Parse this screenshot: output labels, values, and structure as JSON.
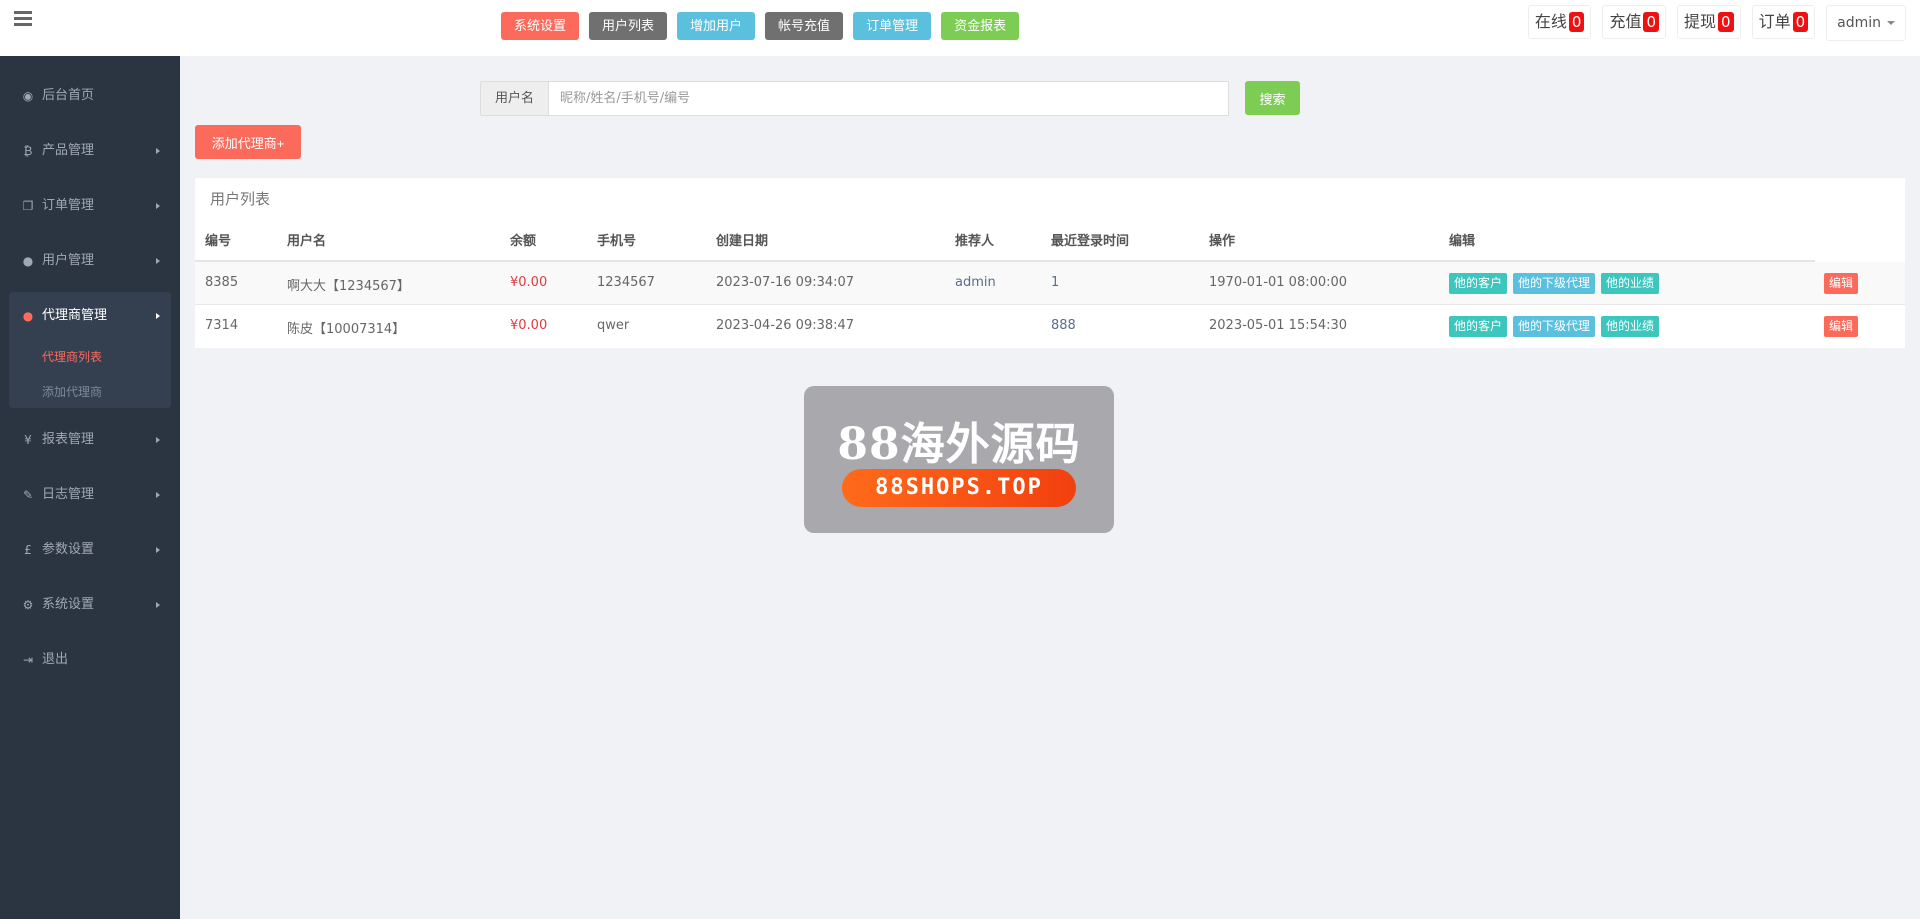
{
  "topbar": {
    "quicknav": [
      {
        "label": "系统设置",
        "color": "#fc6a5b"
      },
      {
        "label": "用户列表",
        "color": "#707070"
      },
      {
        "label": "增加用户",
        "color": "#5bc0de"
      },
      {
        "label": "帐号充值",
        "color": "#707070"
      },
      {
        "label": "订单管理",
        "color": "#5bc0de"
      },
      {
        "label": "资金报表",
        "color": "#7dcd55"
      }
    ],
    "stats": [
      {
        "label": "在线",
        "count": "0"
      },
      {
        "label": "充值",
        "count": "0"
      },
      {
        "label": "提现",
        "count": "0"
      },
      {
        "label": "订单",
        "count": "0"
      }
    ],
    "user": "admin"
  },
  "sidebar": {
    "items": [
      {
        "label": "后台首页",
        "icon": "dashboard-icon",
        "glyph": "◉"
      },
      {
        "label": "产品管理",
        "icon": "bitcoin-icon",
        "glyph": "₿"
      },
      {
        "label": "订单管理",
        "icon": "copy-icon",
        "glyph": "❐"
      },
      {
        "label": "用户管理",
        "icon": "user-icon",
        "glyph": "●"
      },
      {
        "label": "代理商管理",
        "icon": "users-icon",
        "glyph": "●"
      },
      {
        "label": "报表管理",
        "icon": "yen-icon",
        "glyph": "¥"
      },
      {
        "label": "日志管理",
        "icon": "ticket-icon",
        "glyph": "✎"
      },
      {
        "label": "参数设置",
        "icon": "pound-icon",
        "glyph": "£"
      },
      {
        "label": "系统设置",
        "icon": "gears-icon",
        "glyph": "⚙"
      },
      {
        "label": "退出",
        "icon": "sign-out-icon",
        "glyph": "⇥"
      }
    ],
    "sub": [
      "代理商列表",
      "添加代理商"
    ]
  },
  "search": {
    "label": "用户名",
    "placeholder": "昵称/姓名/手机号/编号",
    "button": "搜索"
  },
  "add_agent": "添加代理商+",
  "table": {
    "title": "用户列表",
    "headers": [
      "编号",
      "用户名",
      "余额",
      "手机号",
      "创建日期",
      "推荐人",
      "最近登录时间",
      "操作",
      "编辑"
    ],
    "rows": [
      {
        "id": "8385",
        "name": "啊大大【1234567】",
        "balance": "¥0.00",
        "phone": "1234567",
        "created": "2023-07-16 09:34:07",
        "referrer": "admin",
        "last_login": "1",
        "op": "1970-01-01 08:00:00"
      },
      {
        "id": "7314",
        "name": "陈皮【10007314】",
        "balance": "¥0.00",
        "phone": "qwer",
        "created": "2023-04-26 09:38:47",
        "referrer": "",
        "last_login": "888",
        "op": "2023-05-01 15:54:30"
      }
    ],
    "actions": [
      "他的客户",
      "他的下级代理",
      "他的业绩"
    ],
    "edit": "编辑"
  },
  "watermark": {
    "title": "88海外源码",
    "url": "88SHOPS.TOP"
  }
}
